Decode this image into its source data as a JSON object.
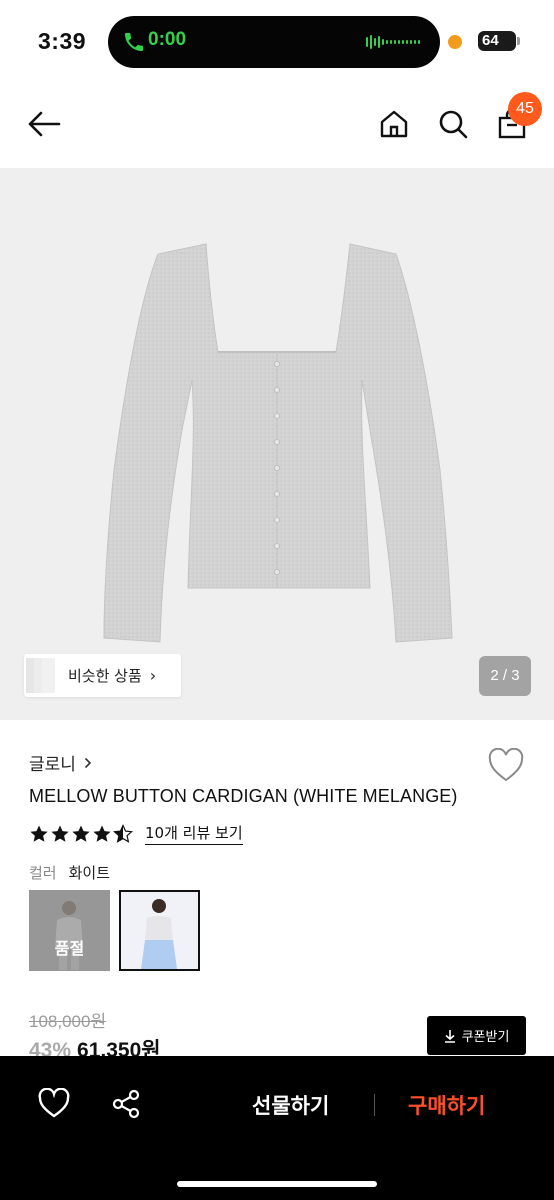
{
  "status_bar": {
    "time": "3:39",
    "call_timer": "0:00",
    "battery": "64"
  },
  "header": {
    "cart_count": "45"
  },
  "gallery": {
    "similar_products_label": "비슷한 상품",
    "page_indicator": "2 / 3"
  },
  "product": {
    "brand": "글로니",
    "name": "MELLOW BUTTON CARDIGAN (WHITE MELANGE)",
    "rating": 4.5,
    "review_link": "10개 리뷰 보기",
    "color_label": "컬러",
    "color_value": "화이트",
    "swatches": [
      {
        "label": "품절",
        "sold_out": true
      },
      {
        "label": "",
        "sold_out": false
      }
    ],
    "original_price": "108,000원",
    "discount": "43%",
    "price": "61,350원",
    "coupon_label": "쿠폰받기"
  },
  "bottom_bar": {
    "gift_label": "선물하기",
    "buy_label": "구매하기"
  },
  "colors": {
    "accent": "#fe4f2a",
    "badge": "#fe5a1d",
    "call_green": "#35d04b"
  }
}
